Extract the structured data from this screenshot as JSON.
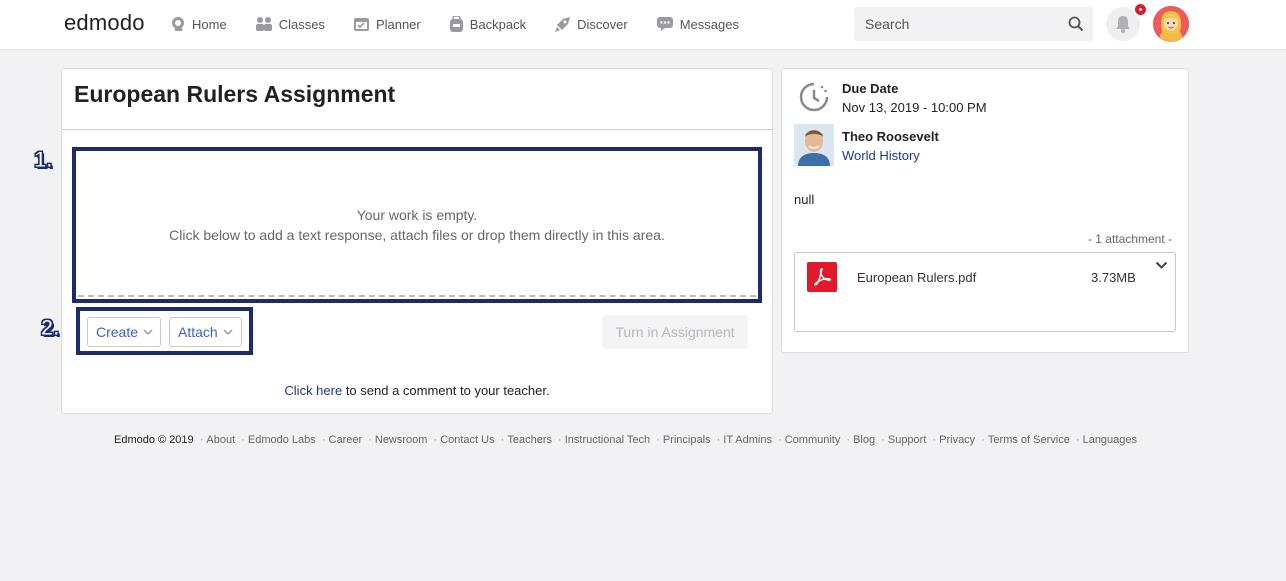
{
  "header": {
    "logo": "edmodo",
    "nav": [
      {
        "label": "Home",
        "icon": "home-icon"
      },
      {
        "label": "Classes",
        "icon": "classes-icon"
      },
      {
        "label": "Planner",
        "icon": "planner-icon"
      },
      {
        "label": "Backpack",
        "icon": "backpack-icon"
      },
      {
        "label": "Discover",
        "icon": "discover-icon"
      },
      {
        "label": "Messages",
        "icon": "messages-icon"
      }
    ],
    "search_placeholder": "Search"
  },
  "assignment": {
    "title": "European Rulers Assignment",
    "empty_line1": "Your work is empty.",
    "empty_line2": "Click below to add a text response, attach files or drop them directly in this area.",
    "create_label": "Create",
    "attach_label": "Attach",
    "turn_in_label": "Turn in Assignment",
    "comment_link": "Click here",
    "comment_rest": " to send a comment to your teacher.",
    "annotation_1": "1.",
    "annotation_2": "2."
  },
  "details": {
    "due_label": "Due Date",
    "due_date": "Nov 13, 2019 - 10:00 PM",
    "teacher_name": "Theo Roosevelt",
    "class_name": "World History",
    "description": "null",
    "attachment_count": "- 1 attachment -",
    "attachment": {
      "name": "European Rulers.pdf",
      "size": "3.73MB"
    }
  },
  "footer": {
    "copyright": "Edmodo © 2019",
    "links": [
      "About",
      "Edmodo Labs",
      "Career",
      "Newsroom",
      "Contact Us",
      "Teachers",
      "Instructional Tech",
      "Principals",
      "IT Admins",
      "Community",
      "Blog",
      "Support",
      "Privacy",
      "Terms of Service",
      "Languages"
    ]
  },
  "colors": {
    "accent_blue": "#3b5fd0",
    "annotation_navy": "#1e2a6e",
    "badge_red": "#e0192d"
  }
}
